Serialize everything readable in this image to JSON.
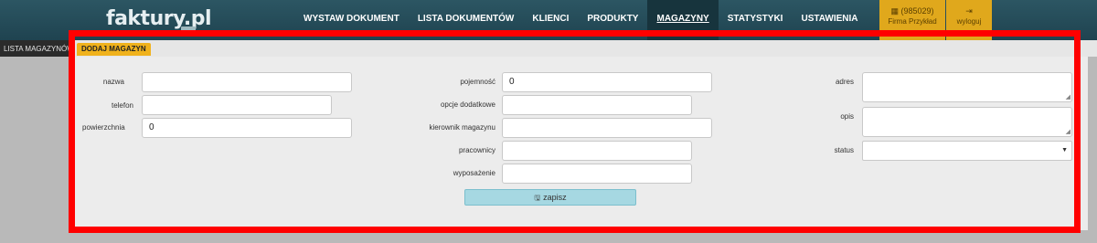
{
  "brand": {
    "logo": "faktury.pl"
  },
  "nav": [
    {
      "label": "WYSTAW DOKUMENT",
      "active": false
    },
    {
      "label": "LISTA DOKUMENTÓW",
      "active": false
    },
    {
      "label": "KLIENCI",
      "active": false
    },
    {
      "label": "PRODUKTY",
      "active": false
    },
    {
      "label": "MAGAZYNY",
      "active": true
    },
    {
      "label": "STATYSTYKI",
      "active": false
    },
    {
      "label": "USTAWIENIA",
      "active": false
    }
  ],
  "user": {
    "account_id": "(985029)",
    "company": "Firma Przykład",
    "logout": "wyloguj"
  },
  "subnav": {
    "list_tab": "LISTA MAGAZYNÓW",
    "add_tab": "DODAJ MAGAZYN"
  },
  "form": {
    "name_label": "nazwa",
    "phone_label": "telefon",
    "area_label": "powierzchnia",
    "area_value": "0",
    "capacity_label": "pojemność",
    "capacity_value": "0",
    "options_label": "opcje dodatkowe",
    "manager_label": "kierownik magazynu",
    "employees_label": "pracownicy",
    "equipment_label": "wyposażenie",
    "address_label": "adres",
    "description_label": "opis",
    "status_label": "status",
    "save_label": "zapisz"
  },
  "accent_colors": {
    "header": "#2c5663",
    "user_box": "#e0a81c",
    "active_subtab": "#f0b21c",
    "save_button": "#a6d8e2",
    "highlight_frame": "#ff0000"
  }
}
